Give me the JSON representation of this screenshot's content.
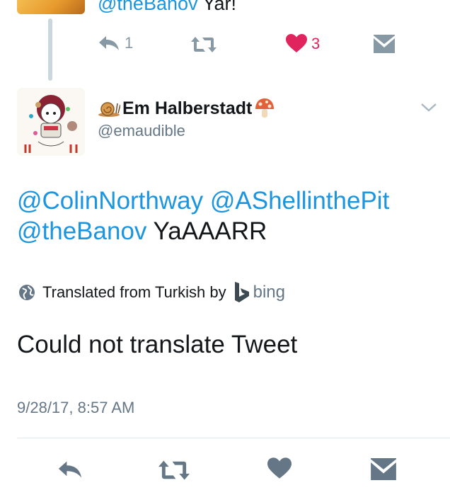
{
  "previous_tweet": {
    "mention": "@theBanov",
    "text": "Yar!",
    "reply_count": "1",
    "like_count": "3"
  },
  "tweet": {
    "display_name": "Em Halberstadt",
    "handle": "@emaudible",
    "mention_1": "@ColinNorthway",
    "mention_2": "@AShellinthePit",
    "mention_3": "@theBanov",
    "text": "YaAAARR",
    "translated_label": "Translated from Turkish by",
    "translator": "bing",
    "translation": "Could not translate Tweet",
    "timestamp": "9/28/17, 8:57 AM"
  },
  "icons": {
    "reply": "reply-icon",
    "retweet": "retweet-icon",
    "like": "heart-icon",
    "dm": "envelope-icon",
    "globe": "globe-icon",
    "bing": "bing-logo-icon",
    "caret": "chevron-down-icon",
    "snail": "snail-emoji",
    "mushroom": "mushroom-emoji"
  },
  "colors": {
    "link": "#1b95e0",
    "like_active": "#e0245e",
    "muted_icon": "#8899a6",
    "secondary_text": "#657786"
  }
}
